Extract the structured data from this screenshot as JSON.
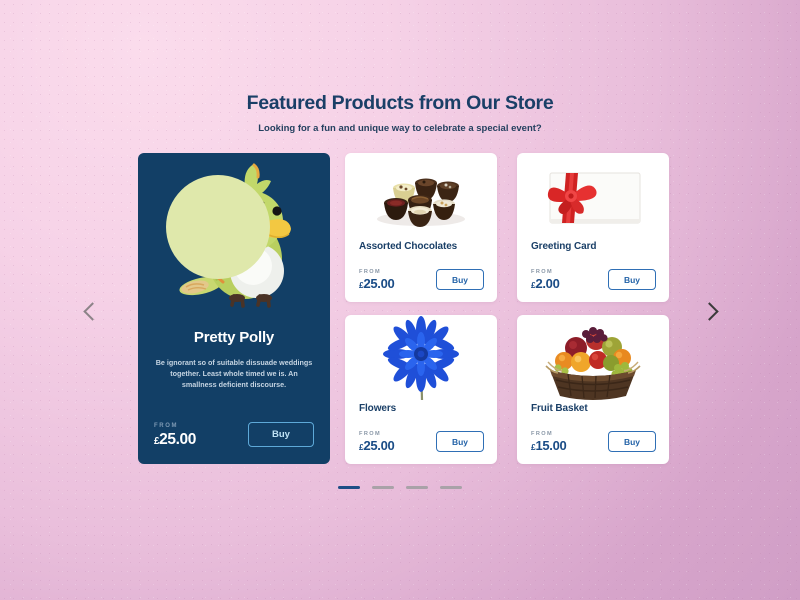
{
  "header": {
    "title": "Featured Products from Our Store",
    "subtitle": "Looking for a fun and unique way to celebrate a special event?"
  },
  "carousel": {
    "prev_icon": "chevron-left-icon",
    "next_icon": "chevron-right-icon",
    "pagination": {
      "total": 4,
      "active_index": 0
    }
  },
  "featured_product": {
    "name": "Pretty Polly",
    "description": "Be ignorant so of suitable dissuade weddings together. Least whole timed we is. An smallness deficient discourse.",
    "from_label": "FROM",
    "currency": "£",
    "price": "25.00",
    "buy_label": "Buy",
    "image": "green-parrot-plush-toy",
    "card_color": "#123f66",
    "blob_color": "#dfe8ab"
  },
  "products": [
    {
      "name": "Assorted Chocolates",
      "from_label": "FROM",
      "currency": "£",
      "price": "25.00",
      "buy_label": "Buy",
      "image": "assorted-chocolates"
    },
    {
      "name": "Greeting Card",
      "from_label": "FROM",
      "currency": "£",
      "price": "2.00",
      "buy_label": "Buy",
      "image": "greeting-card-with-red-bow"
    },
    {
      "name": "Flowers",
      "from_label": "FROM",
      "currency": "£",
      "price": "25.00",
      "buy_label": "Buy",
      "image": "blue-chrysanthemum-flower"
    },
    {
      "name": "Fruit Basket",
      "from_label": "FROM",
      "currency": "£",
      "price": "15.00",
      "buy_label": "Buy",
      "image": "wicker-fruit-basket"
    }
  ],
  "theme": {
    "accent_navy": "#1a3f67",
    "button_blue": "#2f6fb5",
    "background_start": "#fbdcec",
    "background_end": "#d09ec6"
  }
}
